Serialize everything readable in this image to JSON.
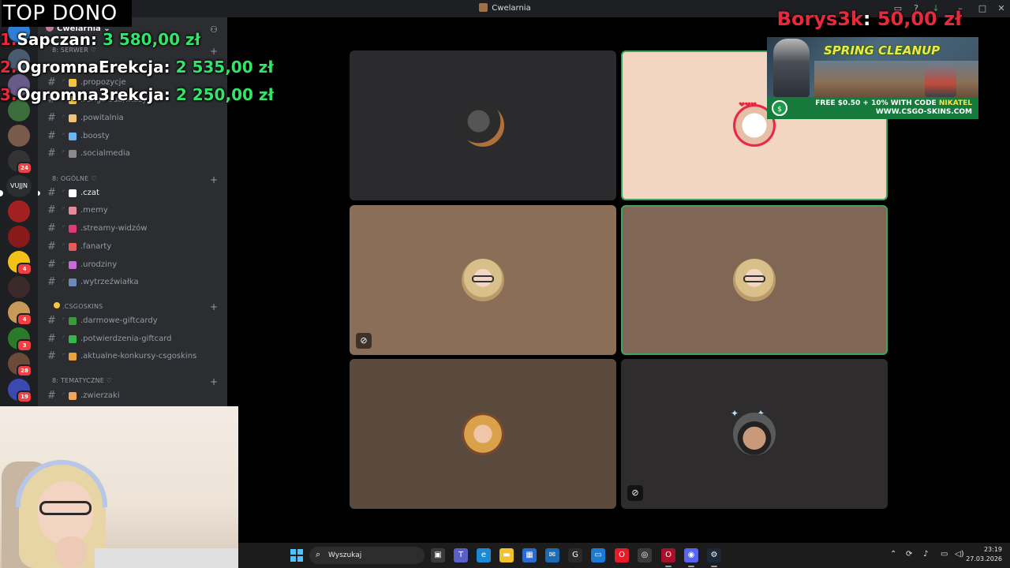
{
  "window": {
    "title": "Cwelarnia",
    "controls": [
      "inbox-icon",
      "help-icon",
      "download-icon",
      "minimize-icon",
      "maximize-icon",
      "close-icon"
    ]
  },
  "server_rail": {
    "servers": [
      {
        "name": "server-1",
        "color": "#2f7fd6",
        "badge": ""
      },
      {
        "name": "server-2",
        "color": "#4a5b6e",
        "badge": ""
      },
      {
        "name": "server-3",
        "color": "#6a5a8a",
        "badge": ""
      },
      {
        "name": "server-4",
        "color": "#3b6e3b",
        "badge": ""
      },
      {
        "name": "server-5",
        "color": "#7a5a4a",
        "badge": ""
      },
      {
        "name": "server-6",
        "color": "#333333",
        "badge": "24"
      },
      {
        "name": "server-8",
        "color": "#a32020",
        "badge": ""
      },
      {
        "name": "server-9",
        "color": "#8a1a1a",
        "badge": ""
      },
      {
        "name": "server-10",
        "color": "#f2c21a",
        "badge": "4"
      },
      {
        "name": "server-11",
        "color": "#3a2a2a",
        "badge": ""
      },
      {
        "name": "server-12",
        "color": "#c79a5a",
        "badge": "4"
      },
      {
        "name": "server-13",
        "color": "#2a7a2a",
        "badge": "3"
      },
      {
        "name": "server-14",
        "color": "#6b4a3a",
        "badge": "28"
      },
      {
        "name": "server-15",
        "color": "#3a4ab0",
        "badge": "19"
      }
    ],
    "text_server": "VUJJN"
  },
  "sidebar": {
    "server_name": "Cwelarnia",
    "categories": [
      {
        "label": "8: SERWER ♡"
      },
      {
        "label": "8: OGÓLNE ♡"
      },
      {
        "label": ".CSGOSKINS"
      },
      {
        "label": "8: TEMATYCZNE ♡"
      }
    ],
    "channels": [
      {
        "label": ".propozycje",
        "emoji_color": "#f4c542"
      },
      {
        "label": ".ranga-sub/xtazy",
        "emoji_color": "#f4c542"
      },
      {
        "label": ".powitalnia",
        "emoji_color": "#f2c27a"
      },
      {
        "label": ".boosty",
        "emoji_color": "#6ab7f5"
      },
      {
        "label": ".socialmedia",
        "emoji_color": "#8a8a8a"
      },
      {
        "label": ".czat",
        "emoji_color": "#ffffff"
      },
      {
        "label": ".memy",
        "emoji_color": "#e88a9a"
      },
      {
        "label": ".streamy-widzów",
        "emoji_color": "#e2387a"
      },
      {
        "label": ".fanarty",
        "emoji_color": "#e85a5a"
      },
      {
        "label": ".urodziny",
        "emoji_color": "#c86ad8"
      },
      {
        "label": ".wytrzeźwiałka",
        "emoji_color": "#6a8ab8"
      },
      {
        "label": ".darmowe-giftcardy",
        "emoji_color": "#3a9a3a"
      },
      {
        "label": ".potwierdzenia-giftcard",
        "emoji_color": "#3ab54a"
      },
      {
        "label": ".aktualne-konkursy-csgoskins",
        "emoji_color": "#e8a43a"
      },
      {
        "label": ".zwierzaki",
        "emoji_color": "#f2a65a"
      }
    ]
  },
  "overlay": {
    "top_dono_title": "TOP DONO",
    "top_donors": [
      {
        "rank": "1.",
        "name": "Sapczan",
        "amount": "3 580,00 zł"
      },
      {
        "rank": "2.",
        "name": "OgromnaErekcja",
        "amount": "2 535,00 zł"
      },
      {
        "rank": "3.",
        "name": "Ogromna3rekcja",
        "amount": "2 250,00 zł"
      }
    ],
    "latest_dono": {
      "name": "Borys3k",
      "amount": "50,00 zł"
    }
  },
  "ad": {
    "headline": "SPRING CLEANUP",
    "promo_line1_prefix": "FREE $0.50 + 10% WITH CODE",
    "promo_code": "NIKATEL",
    "promo_line2": "WWW.CSGO-SKINS.COM"
  },
  "call": {
    "participants": [
      {
        "name": "participant-1",
        "bg": "#2b2a2c",
        "avatar": "dark",
        "speaking": false,
        "muted": false
      },
      {
        "name": "participant-2",
        "bg": "#f2d6c2",
        "avatar": "cartoon",
        "speaking": true,
        "muted": false
      },
      {
        "name": "participant-3",
        "bg": "#8a6e57",
        "avatar": "blonde",
        "speaking": false,
        "muted": true
      },
      {
        "name": "participant-4",
        "bg": "#806654",
        "avatar": "blonde",
        "speaking": true,
        "muted": false
      },
      {
        "name": "participant-5",
        "bg": "#5a4a3e",
        "avatar": "redhead",
        "speaking": false,
        "muted": false
      },
      {
        "name": "participant-6",
        "bg": "#2e2c2d",
        "avatar": "bald",
        "speaking": false,
        "muted": true
      }
    ]
  },
  "taskbar": {
    "search_placeholder": "Wyszukaj",
    "apps": [
      {
        "name": "task-view-icon",
        "color": "#3a3a3a",
        "glyph": "▣"
      },
      {
        "name": "teams-icon",
        "color": "#5b5fc7",
        "glyph": "T"
      },
      {
        "name": "edge-icon",
        "color": "#1a8ad4",
        "glyph": "e"
      },
      {
        "name": "file-explorer-icon",
        "color": "#f2c12e",
        "glyph": "▬"
      },
      {
        "name": "store-icon",
        "color": "#2a6ad4",
        "glyph": "▦"
      },
      {
        "name": "mail-icon",
        "color": "#1a6ab4",
        "glyph": "✉"
      },
      {
        "name": "app-icon",
        "color": "#2a2a2a",
        "glyph": "G"
      },
      {
        "name": "window-icon",
        "color": "#1a7ad4",
        "glyph": "▭"
      },
      {
        "name": "opera-icon",
        "color": "#e81a2a",
        "glyph": "O"
      },
      {
        "name": "chrome-icon",
        "color": "#3a3a3a",
        "glyph": "◎"
      },
      {
        "name": "opera-gx-icon",
        "color": "#a8102a",
        "glyph": "O"
      },
      {
        "name": "discord-icon",
        "color": "#5865f2",
        "glyph": "◉"
      },
      {
        "name": "steam-icon",
        "color": "#1b2838",
        "glyph": "⚙"
      }
    ],
    "time": "23:19",
    "date": "27.03.2026"
  }
}
